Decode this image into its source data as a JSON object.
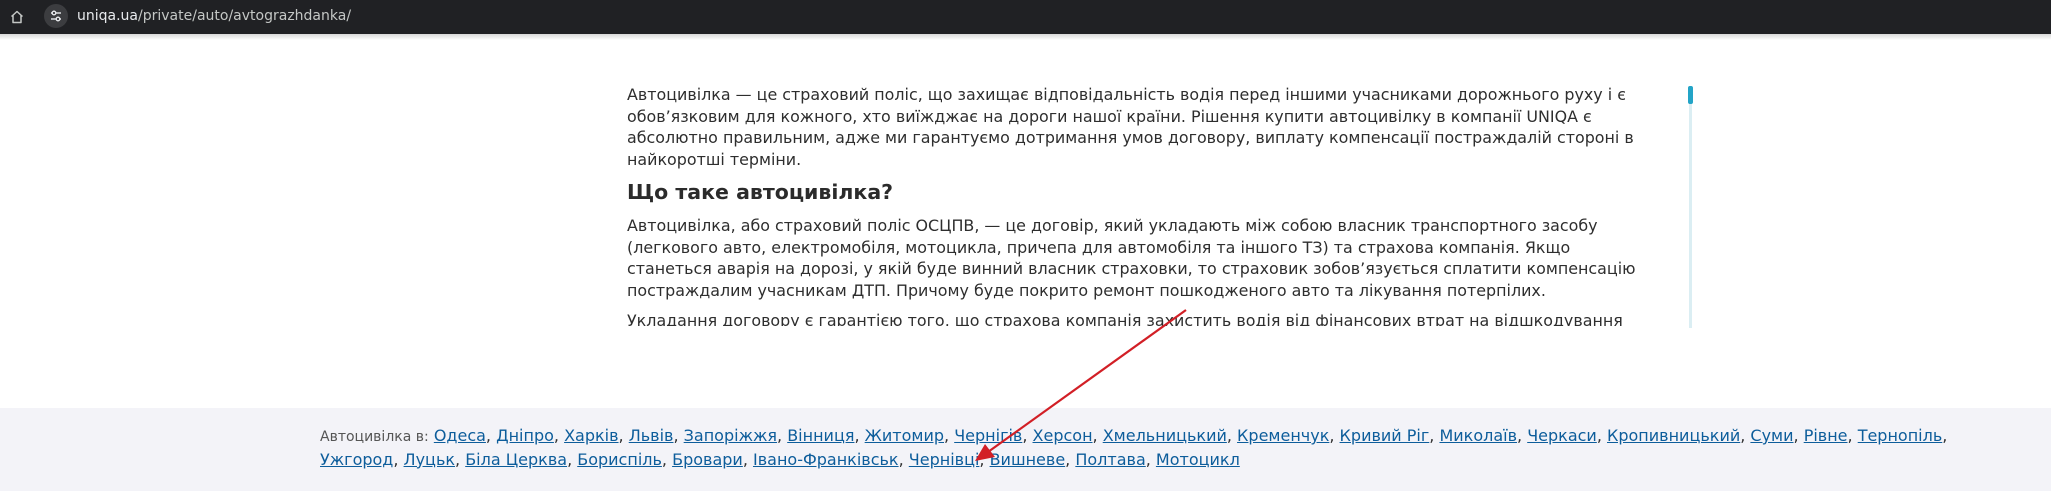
{
  "browser": {
    "url_host": "uniqa.ua",
    "url_path": "/private/auto/avtograzhdanka/"
  },
  "article": {
    "intro": "Автоцивілка — це страховий поліс, що захищає відповідальність водія перед іншими учасниками дорожнього руху і є обов’язковим для кожного, хто виїжджає на дороги нашої країни. Рішення купити автоцивілку в компанії UNIQA є абсолютно правильним, адже ми гарантуємо дотримання умов договору, виплату компенсації постраждалій стороні в найкоротші терміни.",
    "heading": "Що таке автоцивілка?",
    "p1": "Автоцивілка, або страховий поліс ОСЦПВ, — це договір, який укладають між собою власник транспортного засобу (легкового авто, електромобіля, мотоцикла, причепа для автомобіля та іншого ТЗ) та страхова компанія. Якщо станеться аварія на дорозі, у якій буде винний власник страховки, то страховик зобов’язується сплатити компенсацію постраждалим учасникам ДТП. Причому буде покрито ремонт пошкодженого авто та лікування потерпілих.",
    "p2": "Укладання договору є гарантією того, що страхова компанія захистить водія від фінансових втрат на відшкодування збитків постраждалих, але варто пам’ятати, що така страховка є чинною виключно в Україні."
  },
  "footer": {
    "lead": "Автоцивілка в:",
    "cities": [
      "Одеса",
      "Дніпро",
      "Харків",
      "Львів",
      "Запоріжжя",
      "Вінниця",
      "Житомир",
      "Чернігів",
      "Херсон",
      "Хмельницький",
      "Кременчук",
      "Кривий Ріг",
      "Миколаїв",
      "Черкаси",
      "Кропивницький",
      "Суми",
      "Рівне",
      "Тернопіль",
      "Ужгород",
      "Луцьк",
      "Біла Церква",
      "Бориспіль",
      "Бровари",
      "Івано-Франківськ",
      "Чернівці",
      "Вишневе",
      "Полтава",
      "Мотоцикл"
    ]
  },
  "colors": {
    "link": "#0d5d9b",
    "annotation_arrow": "#d21f26",
    "scroll_accent": "#23a4c7"
  }
}
